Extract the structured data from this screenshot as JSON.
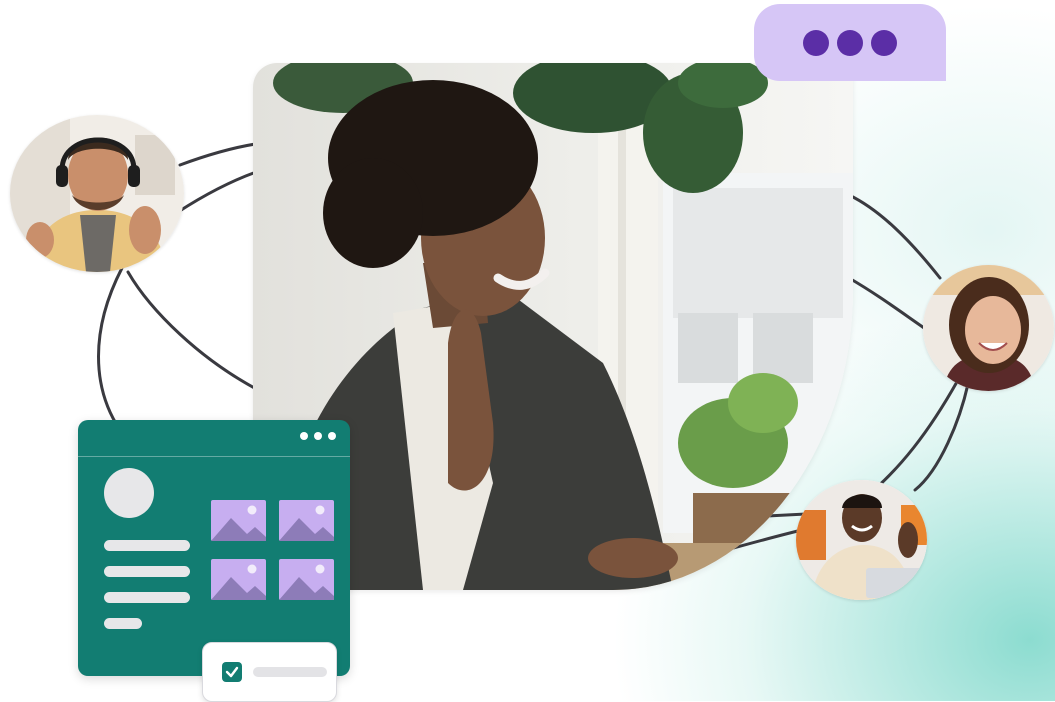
{
  "colors": {
    "accent_teal": "#127d72",
    "bubble_lilac": "#d6c6f6",
    "bubble_dot_purple": "#5b2ea6",
    "thumbnail_lilac": "#c7aef0",
    "placeholder_gray": "#e7e7e9",
    "connector_line": "#3a3a40"
  },
  "main_video": {
    "icon": "woman-waving-video-icon"
  },
  "chat_bubble": {
    "icon": "typing-dots-icon",
    "dot_count": 3
  },
  "participants": [
    {
      "id": "man-headset",
      "icon": "man-with-headset-avatar"
    },
    {
      "id": "woman-laughing",
      "icon": "woman-laughing-avatar"
    },
    {
      "id": "man-laptop",
      "icon": "man-with-laptop-avatar"
    }
  ],
  "profile_card": {
    "window_dots": 3,
    "text_lines": 4,
    "thumbnails": 4,
    "thumbnail_icon": "image-placeholder-icon"
  },
  "check_item": {
    "checked": true,
    "icon": "checkbox-checked-icon"
  }
}
